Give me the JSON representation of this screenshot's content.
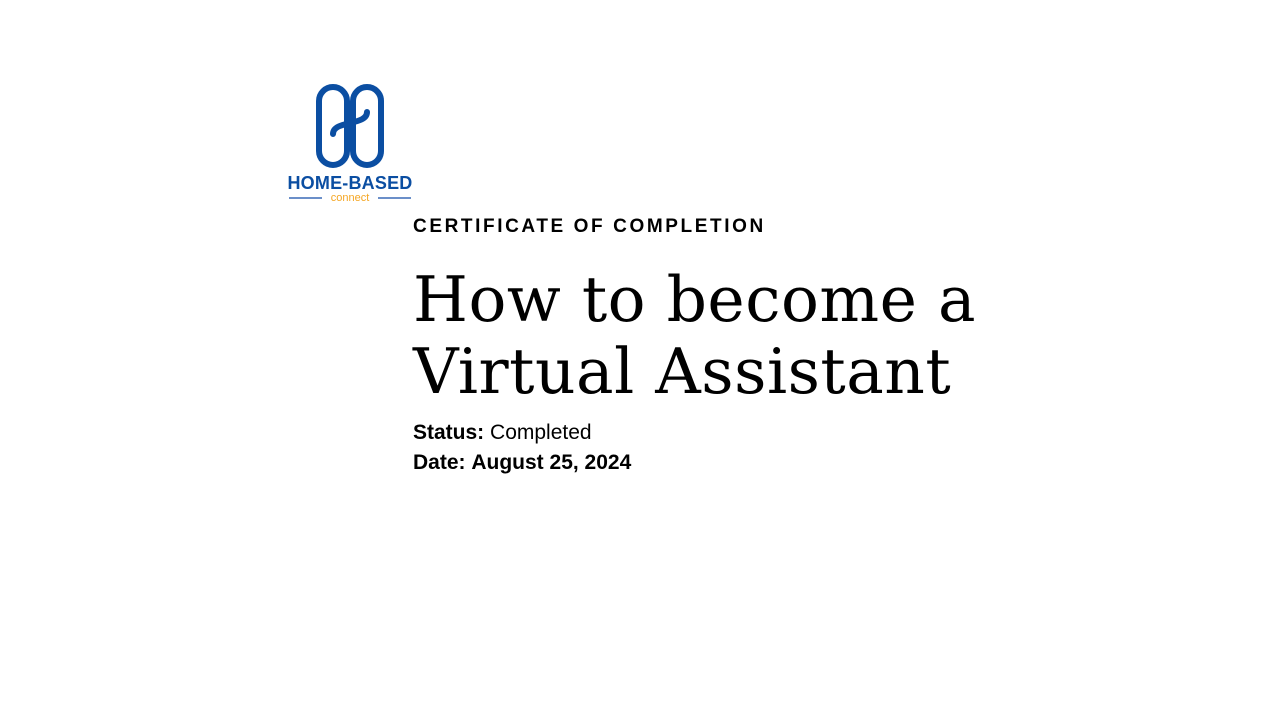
{
  "logo": {
    "brand_top": "HOME-BASED",
    "brand_bottom": "connect",
    "colors": {
      "primary": "#0b4ea2",
      "accent": "#f5a623"
    }
  },
  "certificate": {
    "eyebrow": "CERTIFICATE OF COMPLETION",
    "title_line1": "How to become a",
    "title_line2": "Virtual Assistant",
    "status_label": "Status:",
    "status_value": "Completed",
    "date_label": "Date:",
    "date_value": "August 25, 2024"
  }
}
